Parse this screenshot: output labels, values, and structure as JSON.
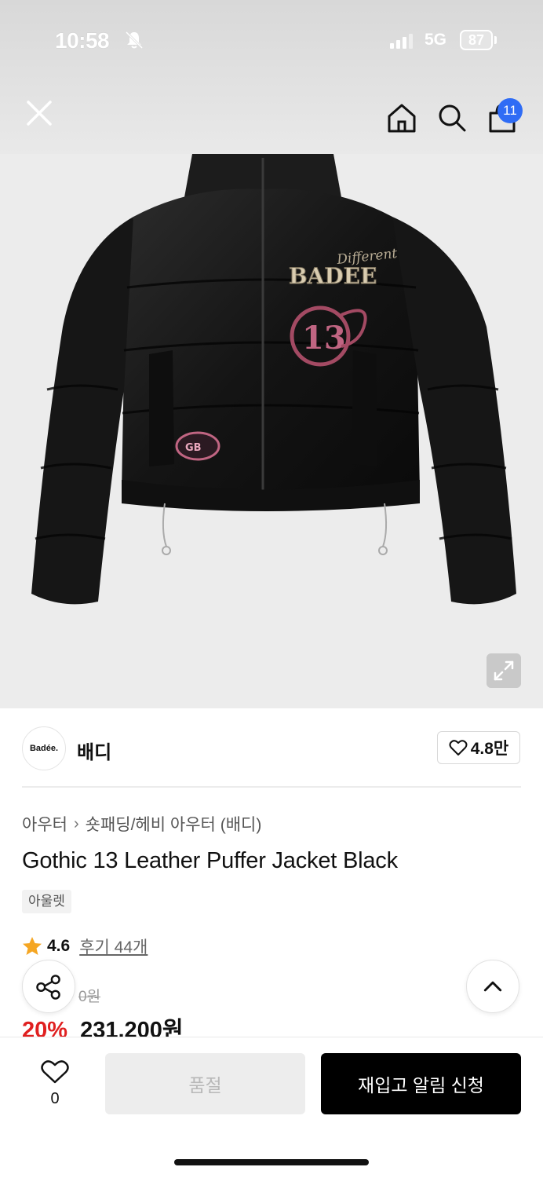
{
  "status_bar": {
    "time": "10:58",
    "network": "5G",
    "battery": "87"
  },
  "nav": {
    "cart_count": "11",
    "icons": [
      "close-icon",
      "home-icon",
      "search-icon",
      "bag-icon"
    ]
  },
  "brand": {
    "logo_text": "Badée.",
    "name": "배디",
    "likes": "4.8만"
  },
  "product": {
    "breadcrumb": [
      "아우터",
      "숏패딩/헤비 아우터 (배디)"
    ],
    "title": "Gothic 13 Leather Puffer Jacket Black",
    "tag": "아울렛",
    "rating": "4.6",
    "reviews": "후기 44개",
    "original_price_fragment": "0원",
    "discount": "20%",
    "price": "231,200원"
  },
  "bottom": {
    "wish_count": "0",
    "soldout_label": "품절",
    "restock_label": "재입고 알림 신청"
  },
  "colors": {
    "accent_badge": "#2f6cf5",
    "discount": "#e02020",
    "star": "#f5a623",
    "primary_button": "#000000"
  }
}
